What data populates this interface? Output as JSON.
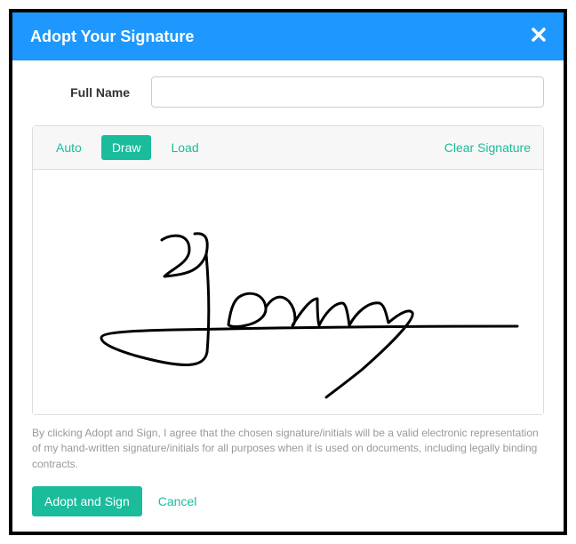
{
  "header": {
    "title": "Adopt Your Signature"
  },
  "form": {
    "full_name_label": "Full Name",
    "full_name_value": ""
  },
  "tabs": {
    "auto": "Auto",
    "draw": "Draw",
    "load": "Load",
    "clear": "Clear Signature"
  },
  "disclaimer": "By clicking Adopt and Sign, I agree that the chosen signature/initials will be a valid electronic representation of my hand-written signature/initials for all purposes when it is used on documents, including legally binding contracts.",
  "actions": {
    "adopt": "Adopt and Sign",
    "cancel": "Cancel"
  }
}
